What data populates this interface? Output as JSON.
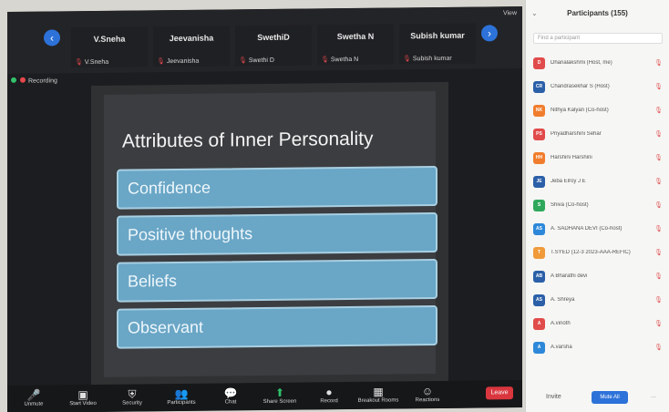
{
  "meeting": {
    "view_label": "View",
    "recording_label": "Recording",
    "tiles": [
      {
        "big": "V.Sneha",
        "small": "V.Sneha"
      },
      {
        "big": "Jeevanisha",
        "small": "Jeevanisha"
      },
      {
        "big": "SwethiD",
        "small": "Swethi D"
      },
      {
        "big": "Swetha N",
        "small": "Swetha N"
      },
      {
        "big": "Subish kumar",
        "small": "Subish kumar"
      }
    ],
    "slide": {
      "title": "Attributes of Inner Personality",
      "bullets": [
        "Confidence",
        "Positive thoughts",
        "Beliefs",
        "Observant"
      ]
    },
    "toolbar": {
      "items": [
        {
          "label": "Unmute",
          "icon": "mic-icon"
        },
        {
          "label": "Start Video",
          "icon": "video-icon"
        },
        {
          "label": "Security",
          "icon": "shield-icon"
        },
        {
          "label": "Participants",
          "icon": "people-icon"
        },
        {
          "label": "Chat",
          "icon": "chat-icon"
        },
        {
          "label": "Share Screen",
          "icon": "share-icon"
        },
        {
          "label": "Record",
          "icon": "record-icon"
        },
        {
          "label": "Breakout Rooms",
          "icon": "grid-icon"
        },
        {
          "label": "Reactions",
          "icon": "smile-icon"
        }
      ],
      "leave_label": "Leave"
    }
  },
  "panel": {
    "title": "Participants (155)",
    "search_placeholder": "Find a participant",
    "participants": [
      {
        "initials": "D",
        "name": "Dhanalakshmi (Host, me)",
        "color": "#e14b4b"
      },
      {
        "initials": "CR",
        "name": "Chandrasekhar S (Host)",
        "color": "#2b5fa8"
      },
      {
        "initials": "NK",
        "name": "Nithya Kalyan (Co-host)",
        "color": "#f07d2d"
      },
      {
        "initials": "PS",
        "name": "Priyadharshini Sehar",
        "color": "#e14b4b"
      },
      {
        "initials": "HH",
        "name": "Harshini Harshini",
        "color": "#f07d2d"
      },
      {
        "initials": "JE",
        "name": "Jeba Elroy J E",
        "color": "#2b5fa8"
      },
      {
        "initials": "S",
        "name": "Shiva (Co-host)",
        "color": "#2fa85c"
      },
      {
        "initials": "AS",
        "name": "A. SADHANA DEVI (Co-host)",
        "color": "#2d88d9"
      },
      {
        "initials": "T",
        "name": "T.SYED (12-3 2023-AAA-REFIC)",
        "color": "#f09a3a"
      },
      {
        "initials": "AB",
        "name": "A Bharathi devi",
        "color": "#2b5fa8"
      },
      {
        "initials": "AS",
        "name": "A. Shreya",
        "color": "#2b5fa8"
      },
      {
        "initials": "A",
        "name": "A.vinoth",
        "color": "#e14b4b"
      },
      {
        "initials": "A",
        "name": "A.varsha",
        "color": "#2d88d9"
      }
    ],
    "invite_label": "Invite",
    "mute_all_label": "Mute All",
    "more_label": "..."
  }
}
